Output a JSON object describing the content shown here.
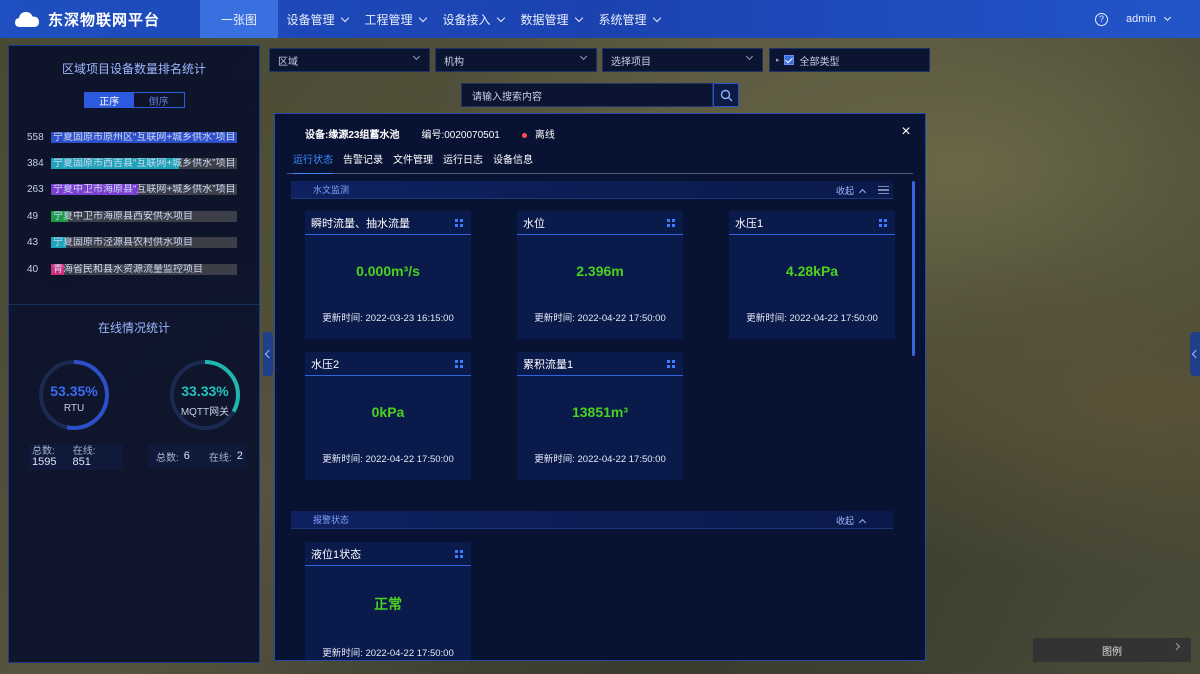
{
  "app": {
    "title": "东深物联网平台"
  },
  "nav": [
    {
      "label": "一张图",
      "active": true,
      "dropdown": false
    },
    {
      "label": "设备管理",
      "dropdown": true
    },
    {
      "label": "工程管理",
      "dropdown": true
    },
    {
      "label": "设备接入",
      "dropdown": true
    },
    {
      "label": "数据管理",
      "dropdown": true
    },
    {
      "label": "系统管理",
      "dropdown": true
    }
  ],
  "user": {
    "name": "admin",
    "help_icon": "?"
  },
  "left_panel": {
    "rank_title": "区域项目设备数量排名统计",
    "sort_asc": "正序",
    "sort_desc": "倒序",
    "rank_items": [
      {
        "count": "558",
        "label": "宁夏固原市原州区“互联网+城乡供水”项目",
        "color": "#2d4fc9",
        "fill": 1.0
      },
      {
        "count": "384",
        "label": "宁夏固原市西吉县“互联网+城乡供水”项目",
        "color": "#1fa3b8",
        "fill": 0.69
      },
      {
        "count": "263",
        "label": "宁夏中卫市海原县“互联网+城乡供水”项目",
        "color": "#7b3fd0",
        "fill": 0.47
      },
      {
        "count": "49",
        "label": "宁夏中卫市海原县西安供水项目",
        "color": "#1f9a4a",
        "fill": 0.09
      },
      {
        "count": "43",
        "label": "宁夏固原市泾源县农村供水项目",
        "color": "#1fa3b8",
        "fill": 0.08
      },
      {
        "count": "40",
        "label": "青海省民和县水资源流量监控项目",
        "color": "#d0307a",
        "fill": 0.07
      }
    ],
    "online_title": "在线情况统计",
    "rtu": {
      "percent": "53.35%",
      "label": "RTU",
      "value": 0.5335,
      "total_label": "总数:",
      "total": "1595",
      "online_label": "在线:",
      "online": "851",
      "color": "#2d4fc9"
    },
    "mqtt": {
      "percent": "33.33%",
      "label": "MQTT网关",
      "value": 0.3333,
      "total_label": "总数:",
      "total": "6",
      "online_label": "在线:",
      "online": "2",
      "color": "#1fb5b0"
    }
  },
  "filters": {
    "region": "区域",
    "org": "机构",
    "project": "选择项目",
    "all_types": "全部类型",
    "search_placeholder": "请输入搜索内容"
  },
  "modal": {
    "device": "设备:缘源23组蓄水池",
    "code": "编号:0020070501",
    "status": "离线",
    "close": "×",
    "tabs": [
      "运行状态",
      "告警记录",
      "文件管理",
      "运行日志",
      "设备信息"
    ],
    "section1": {
      "title": "水文监测",
      "collapse": "收起"
    },
    "section2": {
      "title": "报警状态",
      "collapse": "收起"
    },
    "cards": [
      {
        "title": "瞬时流量、抽水流量",
        "value": "0.000m³/s",
        "time": "更新时间:  2022-03-23 16:15:00"
      },
      {
        "title": "水位",
        "value": "2.396m",
        "time": "更新时间:  2022-04-22 17:50:00"
      },
      {
        "title": "水压1",
        "value": "4.28kPa",
        "time": "更新时间:  2022-04-22 17:50:00"
      },
      {
        "title": "水压2",
        "value": "0kPa",
        "time": "更新时间:  2022-04-22 17:50:00"
      },
      {
        "title": "累积流量1",
        "value": "13851m³",
        "time": "更新时间:  2022-04-22 17:50:00"
      }
    ],
    "alarm_cards": [
      {
        "title": "液位1状态",
        "value": "正常",
        "time": "更新时间:  2022-04-22 17:50:00"
      }
    ]
  },
  "legend_button": "图例",
  "icons": [
    "cloud-icon",
    "help-icon",
    "chevron-down-icon",
    "search-icon",
    "checkbox-icon",
    "close-icon",
    "grid-icon",
    "menu-icon",
    "chevron-up-icon"
  ]
}
